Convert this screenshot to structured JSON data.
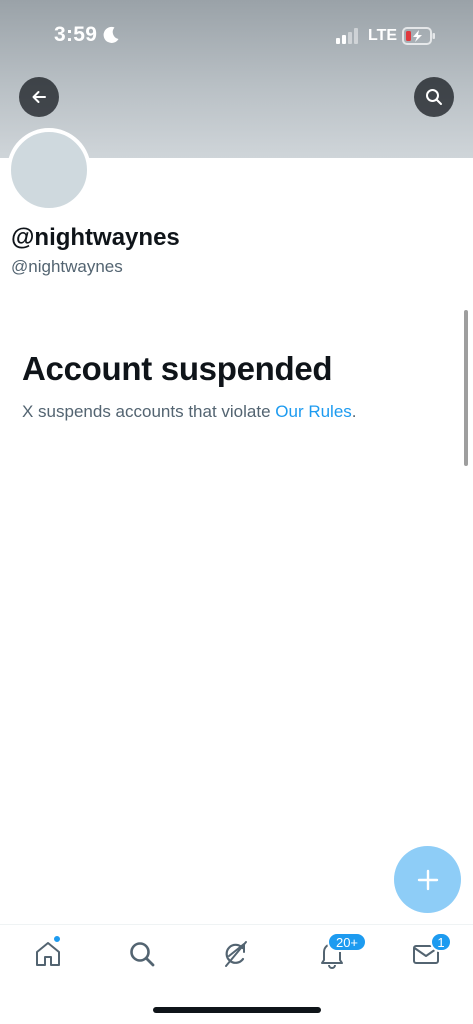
{
  "status_bar": {
    "time": "3:59",
    "network": "LTE",
    "icons": [
      "moon-icon",
      "cellular-signal-icon",
      "battery-charging-icon"
    ]
  },
  "header": {
    "back_icon": "arrow-left-icon",
    "search_icon": "search-icon",
    "banner_color": "#b9c0c5"
  },
  "profile": {
    "display_name": "@nightwaynes",
    "handle": "@nightwaynes"
  },
  "notice": {
    "title": "Account suspended",
    "description": "X suspends accounts that violate ",
    "link_text": "Our Rules",
    "trailing": "."
  },
  "compose": {
    "icon": "plus-icon",
    "color": "#8ecdf7"
  },
  "tab_bar": {
    "items": [
      {
        "name": "home",
        "icon": "home-icon",
        "has_dot": true
      },
      {
        "name": "search",
        "icon": "search-icon"
      },
      {
        "name": "grok",
        "icon": "grok-icon"
      },
      {
        "name": "notifications",
        "icon": "bell-icon",
        "badge": "20+"
      },
      {
        "name": "messages",
        "icon": "envelope-icon",
        "badge": "1"
      }
    ]
  },
  "colors": {
    "accent": "#1d9bf0",
    "text_primary": "#0f1419",
    "text_secondary": "#536471"
  }
}
